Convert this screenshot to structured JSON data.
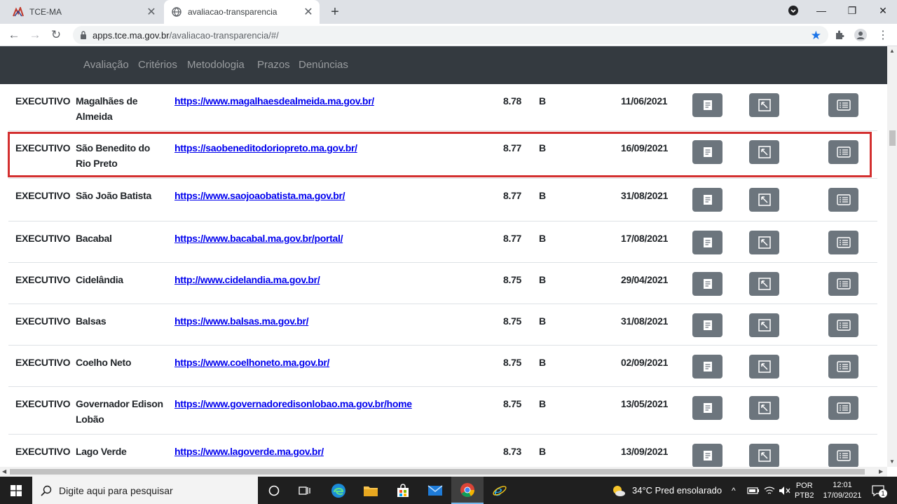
{
  "browser": {
    "tabs": [
      {
        "title": "TCE-MA",
        "active": false
      },
      {
        "title": "avaliacao-transparencia",
        "active": true
      }
    ],
    "url_host": "apps.tce.ma.gov.br",
    "url_path": "/avaliacao-transparencia/#/"
  },
  "site_nav": {
    "links": [
      "Avaliação",
      "Critérios",
      "Metodologia",
      "Prazos",
      "Denúncias"
    ]
  },
  "rows": [
    {
      "tipo": "EXECUTIVO",
      "nome": "Magalhães de Almeida",
      "url": "https://www.magalhaesdealmeida.ma.gov.br/",
      "nota": "8.78",
      "faixa": "B",
      "data": "11/06/2021"
    },
    {
      "tipo": "EXECUTIVO",
      "nome": "São Benedito do Rio Preto",
      "url": "https://saobeneditodoriopreto.ma.gov.br/",
      "nota": "8.77",
      "faixa": "B",
      "data": "16/09/2021"
    },
    {
      "tipo": "EXECUTIVO",
      "nome": "São João Batista",
      "url": "https://www.saojoaobatista.ma.gov.br/",
      "nota": "8.77",
      "faixa": "B",
      "data": "31/08/2021"
    },
    {
      "tipo": "EXECUTIVO",
      "nome": "Bacabal",
      "url": "https://www.bacabal.ma.gov.br/portal/",
      "nota": "8.77",
      "faixa": "B",
      "data": "17/08/2021"
    },
    {
      "tipo": "EXECUTIVO",
      "nome": "Cidelândia",
      "url": "http://www.cidelandia.ma.gov.br/",
      "nota": "8.75",
      "faixa": "B",
      "data": "29/04/2021"
    },
    {
      "tipo": "EXECUTIVO",
      "nome": "Balsas",
      "url": "https://www.balsas.ma.gov.br/",
      "nota": "8.75",
      "faixa": "B",
      "data": "31/08/2021"
    },
    {
      "tipo": "EXECUTIVO",
      "nome": "Coelho Neto",
      "url": "https://www.coelhoneto.ma.gov.br/",
      "nota": "8.75",
      "faixa": "B",
      "data": "02/09/2021"
    },
    {
      "tipo": "EXECUTIVO",
      "nome": "Governador Edison Lobão",
      "url": "https://www.governadoredisonlobao.ma.gov.br/home",
      "nota": "8.75",
      "faixa": "B",
      "data": "13/05/2021"
    },
    {
      "tipo": "EXECUTIVO",
      "nome": "Lago Verde",
      "url": "https://www.lagoverde.ma.gov.br/",
      "nota": "8.73",
      "faixa": "B",
      "data": "13/09/2021"
    }
  ],
  "taskbar": {
    "search_placeholder": "Digite aqui para pesquisar",
    "weather": "34°C  Pred ensolarado",
    "lang_top": "POR",
    "lang_bottom": "PTB2",
    "time": "12:01",
    "date": "17/09/2021",
    "notif_count": "1"
  }
}
